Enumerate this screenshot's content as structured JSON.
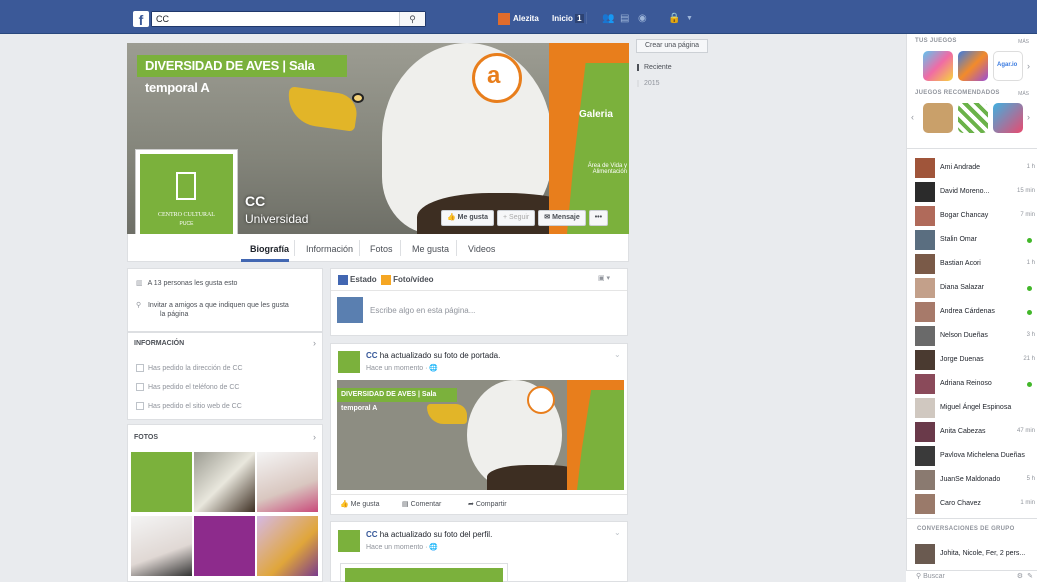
{
  "topbar": {
    "logo": "f",
    "search_value": "CC",
    "search_icon": "⚲",
    "user_name": "Alezita",
    "home_label": "Inicio",
    "home_count": "1"
  },
  "cover": {
    "banner_text": "DIVERSIDAD DE AVES | Sala temporal A",
    "galeria": "Galeria",
    "area_vida": "Área de Vida y Alimentación",
    "page_name": "CC",
    "category": "Universidad",
    "like_btn": "👍 Me gusta",
    "follow_btn": "+ Seguir",
    "message_btn": "✉ Mensaje",
    "more_btn": "•••",
    "profile_line1": "CENTRO CULTURAL",
    "profile_line2": "PUCE"
  },
  "tabs": [
    "Biografía",
    "Información",
    "Fotos",
    "Me gusta",
    "Videos"
  ],
  "right_nav": {
    "create_page": "Crear una página",
    "recent": "Reciente",
    "year": "2015"
  },
  "left": {
    "likes_text": "A 13 personas les gusta esto",
    "invite_text_1": "Invitar a amigos a que indiquen que les gusta",
    "invite_text_2": "la página",
    "info_title": "INFORMACIÓN",
    "info_items": [
      "Has pedido la dirección de CC",
      "Has pedido el teléfono de CC",
      "Has pedido el sitio web de CC"
    ],
    "photos_title": "FOTOS"
  },
  "composer": {
    "status_label": "Estado",
    "photo_label": "Foto/vídeo",
    "placeholder": "Escribe algo en esta página..."
  },
  "posts": [
    {
      "author": "CC",
      "text": " ha actualizado su foto de portada.",
      "time": "Hace un momento · 🌐",
      "like": "Me gusta",
      "comment": "Comentar",
      "share": "Compartir"
    },
    {
      "author": "CC",
      "text": " ha actualizado su foto del perfil.",
      "time": "Hace un momento · 🌐"
    }
  ],
  "sidebar": {
    "games_title": "TUS JUEGOS",
    "more": "MÁS",
    "recommended_title": "JUEGOS RECOMENDADOS",
    "agario_label": "Agar.io",
    "friends": [
      {
        "name": "Ami Andrade",
        "status": "1 h"
      },
      {
        "name": "David Moreno...",
        "status": "15 min"
      },
      {
        "name": "Bogar Chancay",
        "status": "7 min"
      },
      {
        "name": "Stalin Omar",
        "status": "online"
      },
      {
        "name": "Bastian Acori",
        "status": "1 h"
      },
      {
        "name": "Diana Salazar",
        "status": "online"
      },
      {
        "name": "Andrea Cárdenas",
        "status": "online"
      },
      {
        "name": "Nelson Dueñas",
        "status": "3 h"
      },
      {
        "name": "Jorge Duenas",
        "status": "21 h"
      },
      {
        "name": "Adriana Reinoso",
        "status": "online"
      },
      {
        "name": "Miguel Ángel Espinosa",
        "status": ""
      },
      {
        "name": "Anita Cabezas",
        "status": "47 min"
      },
      {
        "name": "Pavlova Michelena Dueñas",
        "status": ""
      },
      {
        "name": "JuanSe Maldonado",
        "status": "5 h"
      },
      {
        "name": "Caro Chavez",
        "status": "1 min"
      }
    ],
    "groups_title": "CONVERSACIONES DE GRUPO",
    "group_name": "Johita, Nicole, Fer, 2 pers...",
    "search_placeholder": "Buscar"
  },
  "colors": {
    "brand_blue": "#3b5998",
    "green": "#7bb13c",
    "orange": "#e87e1c",
    "online": "#42b72a"
  }
}
